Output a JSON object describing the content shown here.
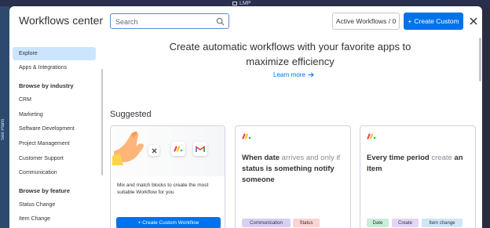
{
  "os_bar": {
    "label": "LMP"
  },
  "side_tab": {
    "label": "See Plans"
  },
  "header": {
    "title": "Workflows center",
    "search_placeholder": "Search",
    "active_workflows": "Active Workflows / 0",
    "create_custom": "Create Custom",
    "create_custom_icon": "+"
  },
  "sidebar": {
    "explore": "Explore",
    "apps_integrations": "Apps & Integrations",
    "industry_heading": "Browse by industry",
    "industries": [
      "CRM",
      "Marketing",
      "Software Development",
      "Project Management",
      "Customer Support",
      "Communication"
    ],
    "feature_heading": "Browse by feature",
    "features": [
      "Status Change",
      "Item Change"
    ]
  },
  "main": {
    "hero_line1": "Create automatic workflows with your favorite apps to",
    "hero_line2": "maximize efficiency",
    "learn_more": "Learn more",
    "suggested": "Suggested"
  },
  "cards": [
    {
      "description": "Mix and match blocks to create the most suitable Workflow for you",
      "button": "+ Create Custom Workflow"
    },
    {
      "title_parts": [
        {
          "text": "When date",
          "style": "bold"
        },
        {
          "text": " arrives and only if ",
          "style": "lite"
        },
        {
          "text": "status is something notify someone",
          "style": "bold"
        }
      ],
      "tags": [
        {
          "label": "Communication",
          "color": "#d8cff3"
        },
        {
          "label": "Status",
          "color": "#fbd3d3"
        }
      ]
    },
    {
      "title_parts": [
        {
          "text": "Every time period",
          "style": "bold"
        },
        {
          "text": " create ",
          "style": "lite"
        },
        {
          "text": "an item",
          "style": "bold"
        }
      ],
      "tags": [
        {
          "label": "Date",
          "color": "#c6efd8"
        },
        {
          "label": "Create",
          "color": "#e2d5f7"
        },
        {
          "label": "Item change",
          "color": "#cfe6f7"
        }
      ]
    }
  ],
  "colors": {
    "accent": "#0073ea",
    "active_item_bg": "#cce5ff",
    "app_bg": "#292f4c"
  }
}
